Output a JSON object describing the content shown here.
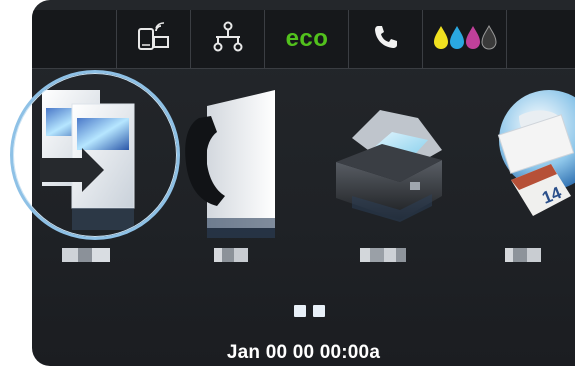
{
  "top_icons": {
    "wireless_direct": "wireless-direct-icon",
    "network": "network-icon",
    "eco_label": "eco",
    "fax_status": "phone-icon",
    "supplies": "ink-drops-icon"
  },
  "colors": {
    "eco": "#52c11d",
    "ring": "#8ec1e6",
    "ink": [
      "#f0e020",
      "#2aa8e0",
      "#c0409a",
      "#303030"
    ]
  },
  "apps": [
    {
      "name": "copy-app",
      "icon": "copy-icon"
    },
    {
      "name": "fax-app",
      "icon": "fax-icon"
    },
    {
      "name": "scan-app",
      "icon": "scanner-icon"
    },
    {
      "name": "apps-app",
      "icon": "globe-calendar-icon",
      "calendar_number": "14"
    }
  ],
  "pager": {
    "pages": 2
  },
  "status_bar": {
    "datetime": "Jan 00 00 00:00a"
  }
}
